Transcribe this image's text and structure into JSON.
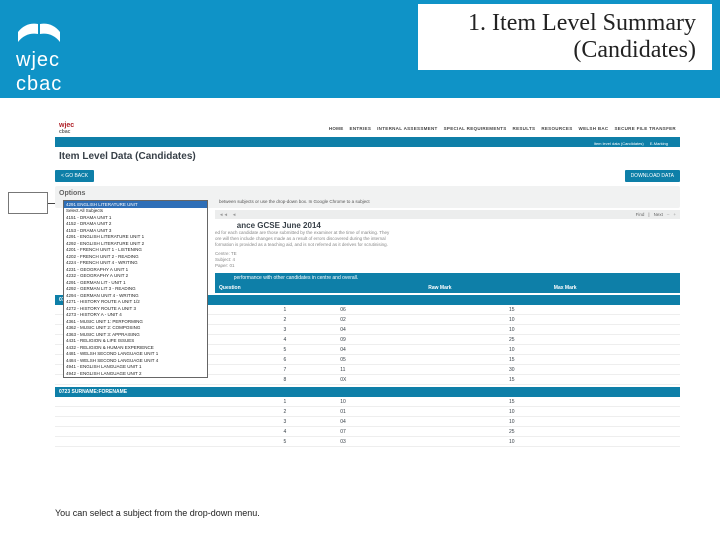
{
  "slide": {
    "title_line1": "1. Item Level Summary",
    "title_line2": "(Candidates)",
    "footer": "You can select a subject from the drop-down menu."
  },
  "brand": {
    "line1": "wjec",
    "line2": "cbac"
  },
  "app": {
    "logo": "wjec",
    "logo_sub": "cbac",
    "nav": [
      "HOME",
      "ENTRIES",
      "INTERNAL ASSESSMENT",
      "SPECIAL REQUIREMENTS",
      "RESULTS",
      "RESOURCES",
      "WELSH BAC",
      "SECURE FILE TRANSFER"
    ],
    "subnav": [
      "Item level data (Candidates)",
      "E-Marking"
    ]
  },
  "page": {
    "title": "Item Level Data (Candidates)",
    "btn_back": "< GO BACK",
    "btn_download": "DOWNLOAD DATA",
    "options_title": "Options",
    "options_hint": "between subjects or use the drop-down box. In Google Chrome to a subject",
    "toolbar": {
      "find": "Find",
      "next": "Next"
    },
    "section_heading_suffix": "ance GCSE June 2014",
    "grey1": "ed for each candidate are those submitted by the examiner at the time of marking. They",
    "grey2": "ore will then include changes made as a result of errors discovered during the internal",
    "grey3": "formation is provided as a teaching aid, and is not referred as it derives for scrutinising.",
    "centre_prefix": "Centre: TE",
    "subject_prefix": "Subject: 4",
    "paper_prefix": "Paper: 01",
    "click_bar": "performance with other candidates in centre and overall.",
    "headers": [
      "Question",
      "Raw Mark",
      "Max Mark"
    ],
    "cand1": "0727 SUI",
    "cand2": "0723 SURNAME:FORENAME"
  },
  "dropdown": {
    "head": "4291 ENGLISH LITERATURE UNIT",
    "opts": [
      "Select All Subjects",
      "4151 - DRAMA UNIT 1",
      "4152 - DRAMA UNIT 2",
      "4153 - DRAMA UNIT 3",
      "4291 - ENGLISH LITERATURE UNIT 1",
      "4292 - ENGLISH LITERATURE UNIT 2",
      "4201 - FRENCH UNIT 1 - LISTENING",
      "4202 - FRENCH UNIT 2 - READING",
      "4224 - FRENCH UNIT 4 - WRITING",
      "4231 - GEOGRAPHY A UNIT 1",
      "4232 - GEOGRAPHY A UNIT 2",
      "4291 - GERMAN LIT - UNIT 1",
      "4292 - GERMAN LIT 3 - READING",
      "4294 - GERMAN UNIT 4 - WRITING",
      "4271 - HISTORY ROUTE A UNIT 1/2",
      "4272 - HISTORY ROUTE A UNIT 3",
      "4273 - HISTORY A - UNIT 4",
      "4361 - MUSIC UNIT 1: PERFORMING",
      "4362 - MUSIC UNIT 2: COMPOSING",
      "4363 - MUSIC UNIT 3: APPRAISING",
      "4431 - RELIGION & LIFE ISSUES",
      "4432 - RELIGION & HUMAN EXPERIENCE",
      "4481 - WELSH SECOND LANGUAGE UNIT 1",
      "4484 - WELSH SECOND LANGUAGE UNIT 4",
      "4941 - ENGLISH LANGUAGE UNIT 1",
      "4942 - ENGLISH LANGUAGE UNIT 2"
    ]
  },
  "rows1": [
    {
      "q": "1",
      "r": "06",
      "m": "15"
    },
    {
      "q": "2",
      "r": "02",
      "m": "10"
    },
    {
      "q": "3",
      "r": "04",
      "m": "10"
    },
    {
      "q": "4",
      "r": "09",
      "m": "25"
    },
    {
      "q": "5",
      "r": "04",
      "m": "10"
    },
    {
      "q": "6",
      "r": "05",
      "m": "15"
    },
    {
      "q": "7",
      "r": "11",
      "m": "30"
    },
    {
      "q": "8",
      "r": "0X",
      "m": "15"
    }
  ],
  "rows2": [
    {
      "q": "1",
      "r": "10",
      "m": "15"
    },
    {
      "q": "2",
      "r": "01",
      "m": "10"
    },
    {
      "q": "3",
      "r": "04",
      "m": "10"
    },
    {
      "q": "4",
      "r": "07",
      "m": "25"
    },
    {
      "q": "5",
      "r": "03",
      "m": "10"
    }
  ]
}
